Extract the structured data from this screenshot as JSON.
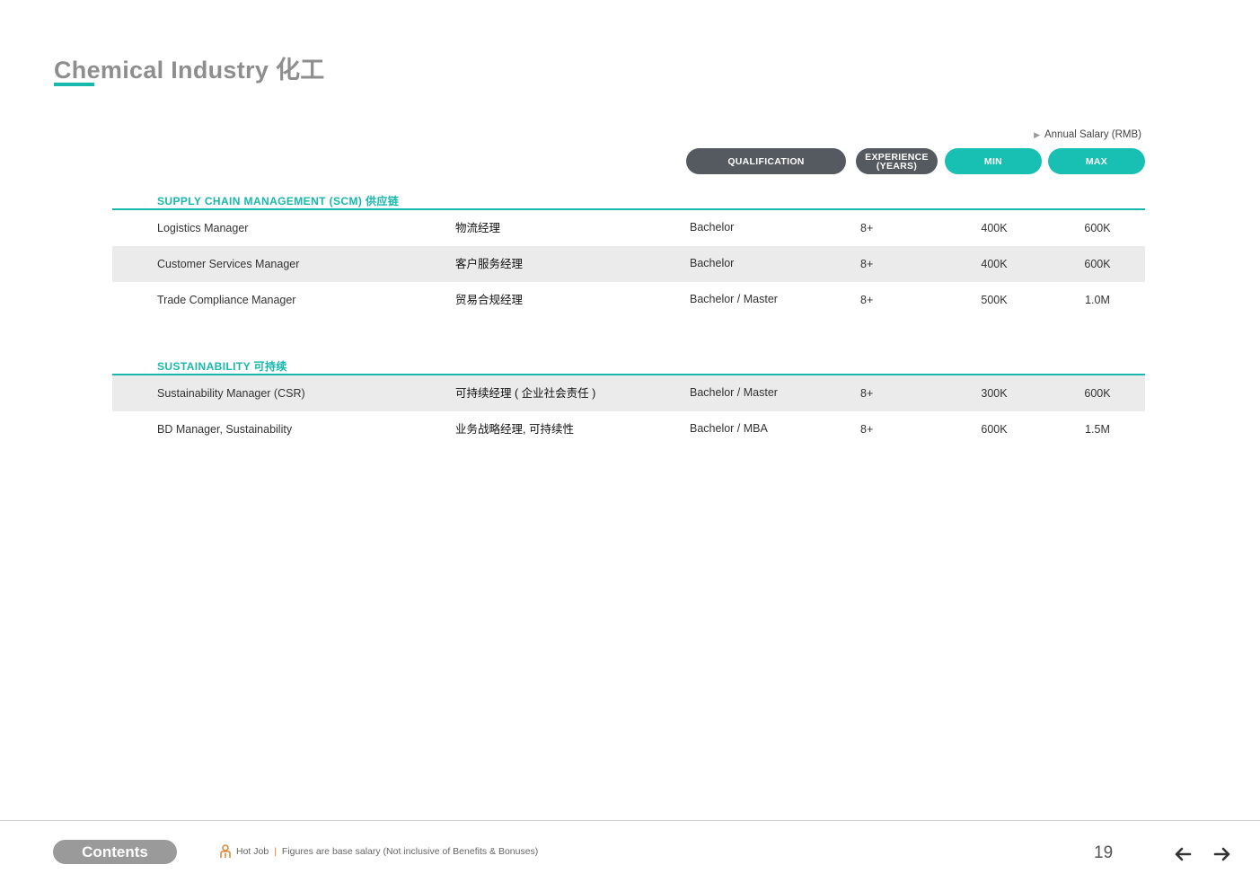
{
  "page": {
    "title": "Chemical Industry 化工",
    "salary_note": "Annual Salary (RMB)",
    "page_number": "19"
  },
  "headers": {
    "qualification": "QUALIFICATION",
    "experience_line1": "EXPERIENCE",
    "experience_line2": "(YEARS)",
    "min": "MIN",
    "max": "MAX"
  },
  "sections": [
    {
      "title": "SUPPLY CHAIN MANAGEMENT (SCM) 供应链",
      "rows": [
        {
          "en": "Logistics Manager",
          "cn": "物流经理",
          "qualification": "Bachelor",
          "experience": "8+",
          "min": "400K",
          "max": "600K"
        },
        {
          "en": "Customer Services Manager",
          "cn": "客户服务经理",
          "qualification": "Bachelor",
          "experience": "8+",
          "min": "400K",
          "max": "600K"
        },
        {
          "en": "Trade Compliance Manager",
          "cn": "贸易合规经理",
          "qualification": "Bachelor / Master",
          "experience": "8+",
          "min": "500K",
          "max": "1.0M"
        }
      ]
    },
    {
      "title": "SUSTAINABILITY 可持续",
      "rows": [
        {
          "en": "Sustainability Manager (CSR)",
          "cn": "可持续经理 ( 企业社会责任 )",
          "qualification": "Bachelor / Master",
          "experience": "8+",
          "min": "300K",
          "max": "600K"
        },
        {
          "en": "BD Manager, Sustainability",
          "cn": "业务战略经理, 可持续性",
          "qualification": "Bachelor / MBA",
          "experience": "8+",
          "min": "600K",
          "max": "1.5M"
        }
      ]
    }
  ],
  "footer": {
    "contents_label": "Contents",
    "hot_job_label": "Hot Job",
    "separator": "|",
    "note": "Figures are base salary (Not inclusive of Benefits & Bonuses)"
  },
  "colors": {
    "accent": "#17b8ad",
    "pill_dark": "#555a60",
    "pill_teal": "#17c0b3",
    "row_shade": "#ebebeb",
    "hot_job_icon": "#e08a3a"
  },
  "icons": {
    "hot_job": "person-icon",
    "prev": "arrow-left-icon",
    "next": "arrow-right-icon",
    "note_marker": "triangle-right-icon"
  }
}
